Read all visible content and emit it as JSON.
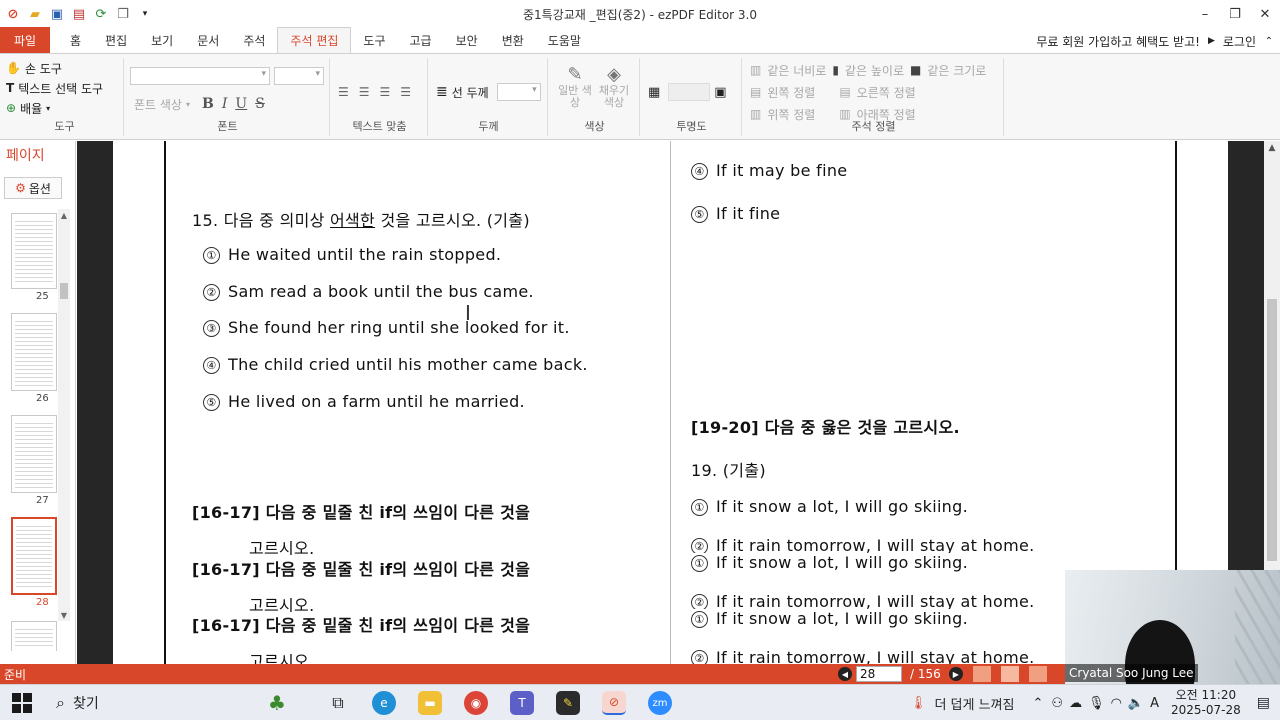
{
  "window": {
    "title": "중1특강교재 _편집(중2) - ezPDF Editor 3.0"
  },
  "menu": {
    "file": "파일",
    "tabs": [
      "홈",
      "편집",
      "보기",
      "문서",
      "주석",
      "주석 편집",
      "도구",
      "고급",
      "보안",
      "변환",
      "도움말"
    ],
    "promo": "무료 회원 가입하고 혜택도 받고!",
    "login": "로그인"
  },
  "ribbon": {
    "tools": {
      "hand": "손 도구",
      "text_select": "텍스트 선택 도구",
      "arrange": "배율",
      "label": "도구"
    },
    "font": {
      "color": "폰트 색상",
      "label": "폰트"
    },
    "align": {
      "label": "텍스트 맞춤"
    },
    "thickness": {
      "line": "선 두께",
      "label": "두께"
    },
    "color": {
      "general": "일반 색상",
      "fill": "채우기 색상",
      "label": "색상"
    },
    "transparency": {
      "label": "투명도"
    },
    "annot_align": {
      "same_width": "같은 너비로",
      "same_height": "같은 높이로",
      "same_size": "같은 크기로",
      "left": "왼쪽 정렬",
      "right": "오른쪽 정렬",
      "top": "위쪽 정렬",
      "bottom": "아래쪽 정렬",
      "label": "주석 정렬"
    }
  },
  "pages_panel": {
    "title": "페이지",
    "options": "옵션",
    "thumbnails": [
      "25",
      "26",
      "27",
      "28"
    ],
    "selected": "28"
  },
  "document": {
    "q15_title_prefix": "15. 다음 중 의미상 ",
    "q15_title_underline": "어색한",
    "q15_title_suffix": " 것을 고르시오. (기출)",
    "q15_choices": [
      "He waited until the rain stopped.",
      "Sam read a book until the bus came.",
      "She found her ring until she looked for it.",
      "The child cried until his mother came back.",
      "He lived on a farm until he married."
    ],
    "q16_17_title": "[16-17] 다음 중 밑줄 친 if의 쓰임이 다른 것을",
    "q16_17_cont": "고르시오.",
    "prev_choices": [
      "If it may be fine",
      "If it fine"
    ],
    "q19_20_title": "[19-20] 다음 중 옳은 것을 고르시오.",
    "q19_title": "19.  (기출)",
    "q19_choice1": "If it snow a lot, I will go skiing.",
    "q19_choice2": "If it rain tomorrow, I will stay at home.",
    "circled": [
      "①",
      "②",
      "③",
      "④",
      "⑤"
    ]
  },
  "status": {
    "ready": "준비",
    "page_current": "28",
    "page_total": "/ 156"
  },
  "video": {
    "name": "Cryatal Soo Jung Lee"
  },
  "taskbar": {
    "search": "찾기",
    "weather": "더 덥게 느껴짐",
    "ime": "A",
    "time": "오전 11:20",
    "date": "2025-07-28"
  },
  "colors": {
    "accent": "#d9472b",
    "doc_bg": "#262626",
    "taskbar": "#e9edf3"
  }
}
